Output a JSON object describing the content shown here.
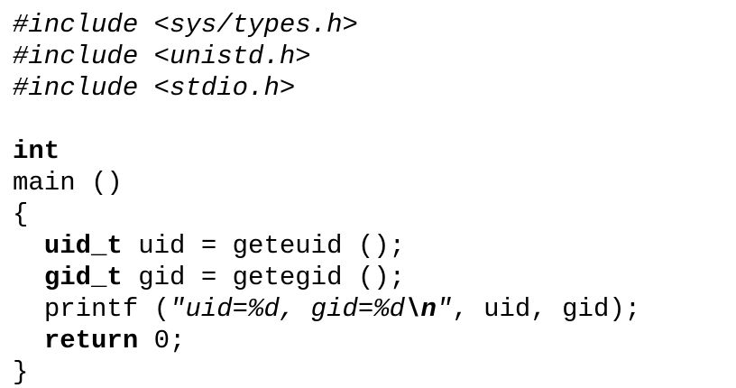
{
  "code": {
    "include_directive": "#include",
    "includes": [
      "<sys/types.h>",
      "<unistd.h>",
      "<stdio.h>"
    ],
    "return_type": "int",
    "func_signature": "main ()",
    "open_brace": "{",
    "close_brace": "}",
    "uid_type": "uid_t",
    "uid_rest": " uid = geteuid ();",
    "gid_type": "gid_t",
    "gid_rest": " gid = getegid ();",
    "printf_call": "printf (",
    "format_open": "\"uid=%d, gid=%d",
    "escape": "\\n",
    "format_close": "\"",
    "printf_args": ", uid, gid);",
    "return_keyword": "return",
    "return_rest": " 0;"
  }
}
